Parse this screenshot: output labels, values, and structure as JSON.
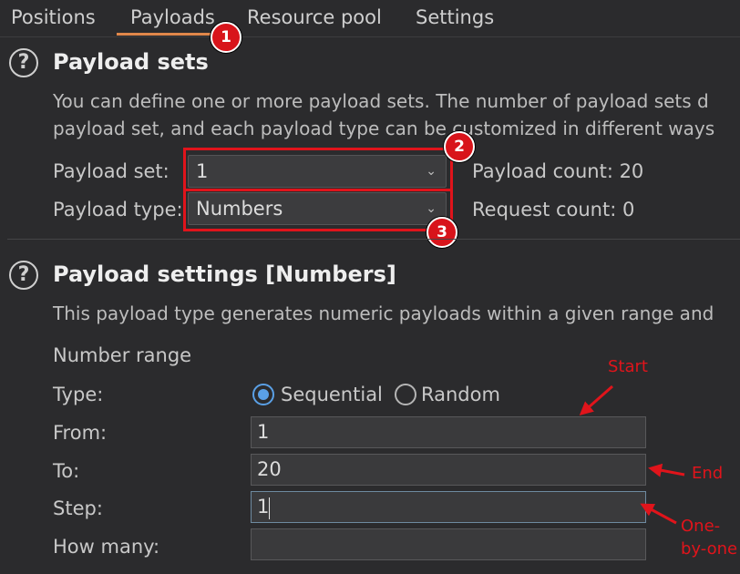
{
  "tabs": [
    "Positions",
    "Payloads",
    "Resource pool",
    "Settings"
  ],
  "payload_sets": {
    "title": "Payload sets",
    "description_line1": "You can define one or more payload sets. The number of payload sets d",
    "description_line2": "payload set, and each payload type can be customized in different ways",
    "set_label": "Payload set:",
    "set_value": "1",
    "type_label": "Payload type:",
    "type_value": "Numbers",
    "payload_count": "Payload count: 20",
    "request_count": "Request count: 0"
  },
  "payload_settings": {
    "title": "Payload settings [Numbers]",
    "description": "This payload type generates numeric payloads within a given range and",
    "number_range": "Number range",
    "type_label": "Type:",
    "sequential": "Sequential",
    "random": "Random",
    "selected_type": "Sequential",
    "from_label": "From:",
    "from_value": "1",
    "to_label": "To:",
    "to_value": "20",
    "step_label": "Step:",
    "step_value": "1",
    "how_many_label": "How many:",
    "how_many_value": ""
  },
  "badges": [
    "1",
    "2",
    "3"
  ],
  "annotations": {
    "start": "Start",
    "end": "End",
    "one_line1": "One-",
    "one_line2": "by-one"
  },
  "colors": {
    "background": "#2b2b2d",
    "accent_tab": "#e0874a",
    "annotation_red": "#e0141b",
    "radio_blue": "#5aa0e6"
  }
}
